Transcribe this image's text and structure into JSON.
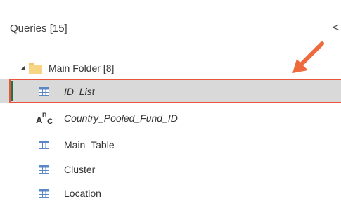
{
  "header": {
    "title": "Queries [15]",
    "collapse_glyph": "<"
  },
  "folder": {
    "label": "Main Folder [8]",
    "icon": "folder-icon",
    "expand_icon": "triangle-expanded-icon"
  },
  "queries": [
    {
      "label": "ID_List",
      "icon": "table-icon",
      "italic": true,
      "selected": true
    },
    {
      "label": "Country_Pooled_Fund_ID",
      "icon": "abc-text-icon",
      "italic": true,
      "selected": false
    },
    {
      "label": "Main_Table",
      "icon": "table-icon",
      "italic": false,
      "selected": false
    },
    {
      "label": "Cluster",
      "icon": "table-icon",
      "italic": false,
      "selected": false
    },
    {
      "label": "Location",
      "icon": "table-icon",
      "italic": false,
      "selected": false
    }
  ],
  "abc_icon_glyphs": {
    "a": "A",
    "b": "B",
    "c": "C"
  },
  "colors": {
    "highlight_outline": "#e8553a",
    "selection_bg": "#d9d9d9",
    "selection_accent": "#217346",
    "table_icon": "#5b87c4",
    "folder": "#f7d582",
    "annotation_arrow": "#ee6a3c"
  }
}
